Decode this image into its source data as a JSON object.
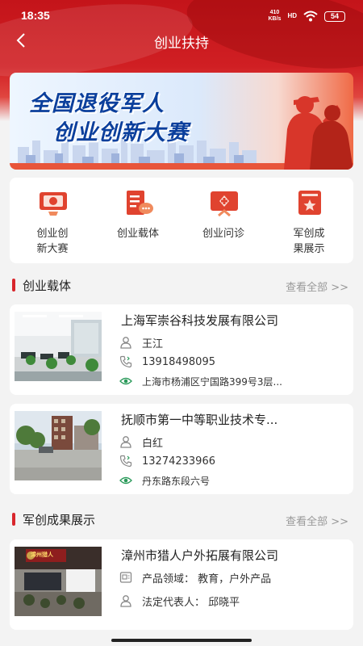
{
  "status_bar": {
    "time": "18:35",
    "net_speed": "410",
    "net_unit": "KB/s",
    "network": "HD",
    "battery": "54"
  },
  "nav": {
    "title": "创业扶持"
  },
  "banner": {
    "line1": "全国退役军人",
    "line2": "创业创新大赛"
  },
  "menu": [
    {
      "label": "创业创新大赛",
      "icon": "award-certificate-icon"
    },
    {
      "label": "创业载体",
      "icon": "document-chat-icon"
    },
    {
      "label": "创业问诊",
      "icon": "consult-board-icon"
    },
    {
      "label": "军创成果展示",
      "icon": "star-book-icon"
    }
  ],
  "section1": {
    "title": "创业载体",
    "more": "查看全部 >>",
    "items": [
      {
        "title": "上海军崇谷科技发展有限公司",
        "contact": "王江",
        "phone": "13918498095",
        "address": "上海市杨浦区宁国路399号3层..."
      },
      {
        "title": "抚顺市第一中等职业技术专...",
        "contact": "白红",
        "phone": "13274233966",
        "address": "丹东路东段六号"
      }
    ]
  },
  "section2": {
    "title": "军创成果展示",
    "more": "查看全部 >>",
    "items": [
      {
        "title": "漳州市猎人户外拓展有限公司",
        "field": "产品领域： 教育，户外产品",
        "legal": "法定代表人： 邱晓平",
        "photo_sign": "漳州猎人"
      }
    ]
  },
  "colors": {
    "brand_red": "#d01f23",
    "section_bar": "#d8262c",
    "icon_red": "#e0432f",
    "banner_blue": "#0b3f9c"
  }
}
